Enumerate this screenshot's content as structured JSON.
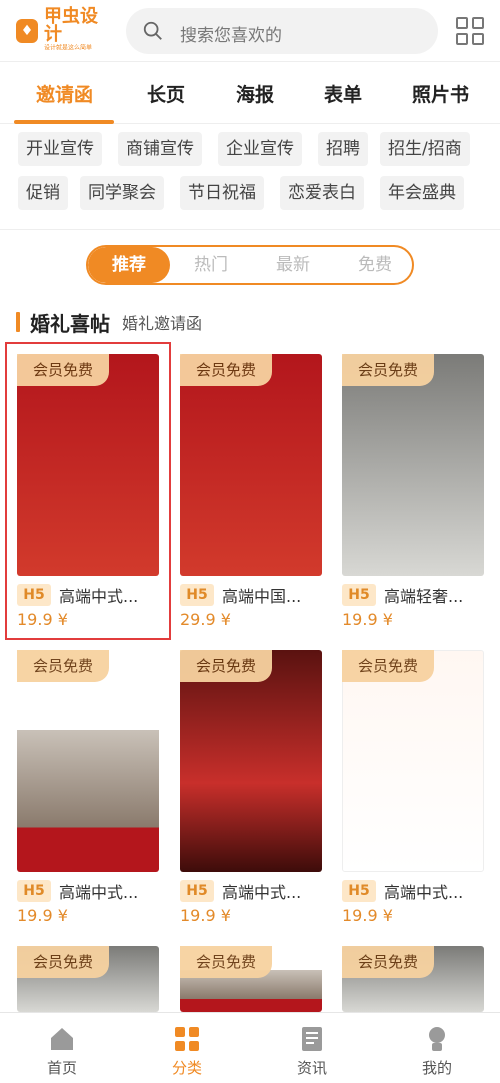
{
  "header": {
    "logo_name": "甲虫设计",
    "logo_sub": "设计就是这么简单",
    "search_placeholder": "搜索您喜欢的"
  },
  "tabs": [
    "邀请函",
    "长页",
    "海报",
    "表单",
    "照片书"
  ],
  "active_tab": "邀请函",
  "chips": [
    [
      "开业宣传",
      "商铺宣传",
      "企业宣传",
      "招聘",
      "招生/招商"
    ],
    [
      "促销",
      "同学聚会",
      "节日祝福",
      "恋爱表白",
      "年会盛典"
    ]
  ],
  "segment": [
    "推荐",
    "热门",
    "最新",
    "免费"
  ],
  "active_segment": "推荐",
  "section": {
    "title": "婚礼喜帖",
    "subtitle": "婚礼邀请函"
  },
  "cards": [
    {
      "badge": "会员免费",
      "tag": "H5",
      "title": "高端中式...",
      "price": "19.9 ¥"
    },
    {
      "badge": "会员免费",
      "tag": "H5",
      "title": "高端中国...",
      "price": "29.9 ¥"
    },
    {
      "badge": "会员免费",
      "tag": "H5",
      "title": "高端轻奢...",
      "price": "19.9 ¥"
    },
    {
      "badge": "会员免费",
      "tag": "H5",
      "title": "高端中式...",
      "price": "19.9 ¥"
    },
    {
      "badge": "会员免费",
      "tag": "H5",
      "title": "高端中式...",
      "price": "19.9 ¥"
    },
    {
      "badge": "会员免费",
      "tag": "H5",
      "title": "高端中式...",
      "price": "19.9 ¥"
    },
    {
      "badge": "会员免费"
    },
    {
      "badge": "会员免费"
    },
    {
      "badge": "会员免费"
    }
  ],
  "bottom_nav": [
    {
      "label": "首页",
      "icon": "home-icon"
    },
    {
      "label": "分类",
      "icon": "category-icon"
    },
    {
      "label": "资讯",
      "icon": "news-icon"
    },
    {
      "label": "我的",
      "icon": "user-icon"
    }
  ],
  "active_bottom": "分类",
  "colors": {
    "accent": "#f08a24",
    "price": "#e38a2a"
  }
}
